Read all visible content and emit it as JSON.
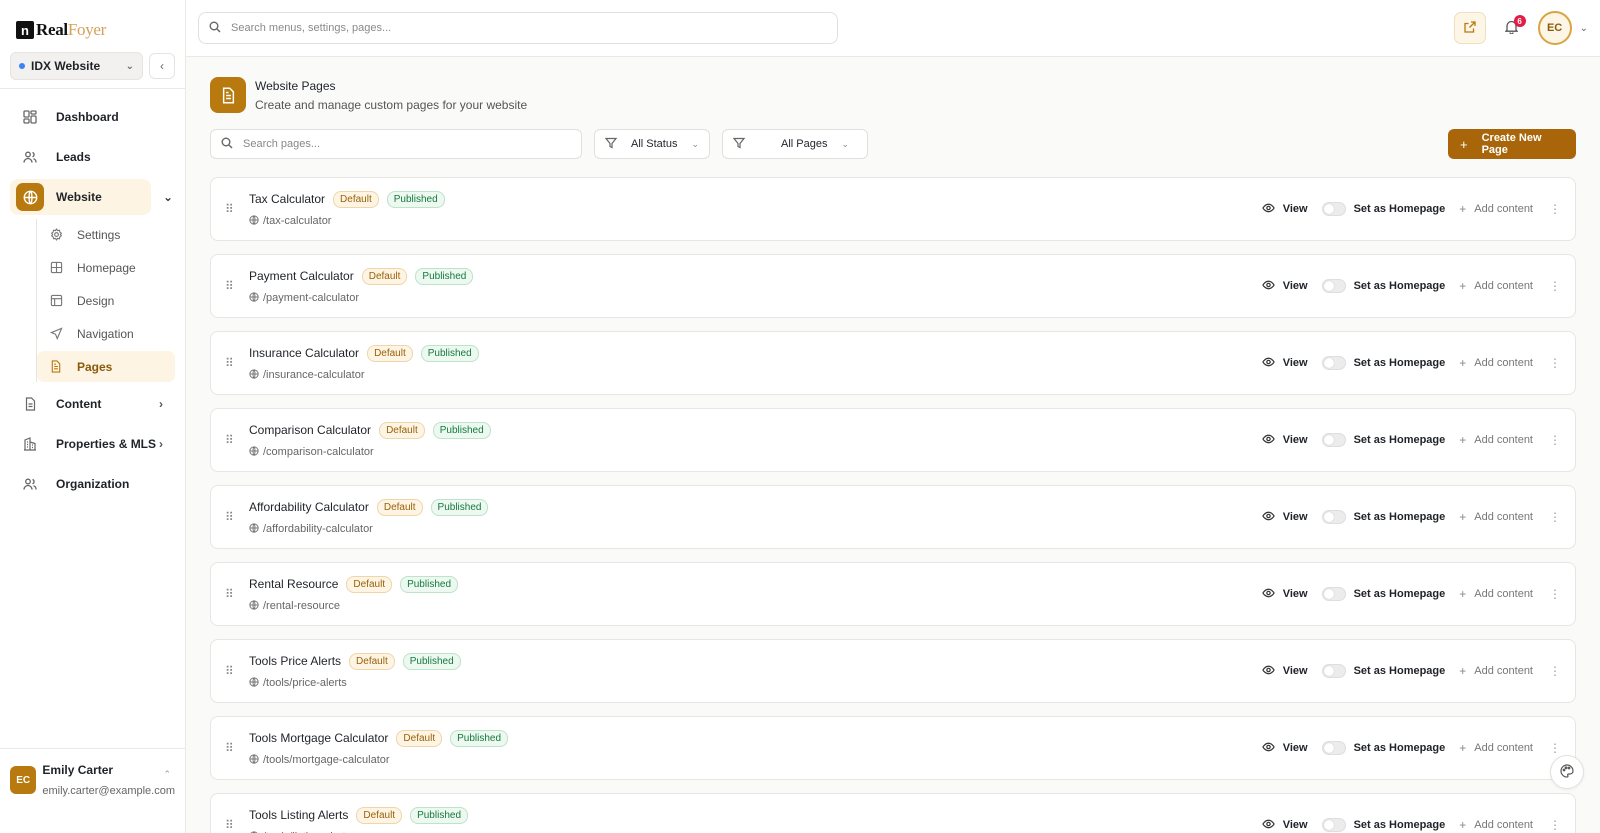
{
  "brand": {
    "mark": "n",
    "name_part1": "Real",
    "name_part2": "Foyer"
  },
  "site_selector": {
    "value": "IDX Website"
  },
  "sidebar": {
    "items": [
      {
        "label": "Dashboard",
        "icon": "grid-icon"
      },
      {
        "label": "Leads",
        "icon": "users-icon"
      },
      {
        "label": "Website",
        "icon": "globe-icon",
        "active": true
      },
      {
        "label": "Content",
        "icon": "document-icon"
      },
      {
        "label": "Properties & MLS",
        "icon": "building-icon"
      },
      {
        "label": "Organization",
        "icon": "team-icon"
      }
    ],
    "subitems": [
      {
        "label": "Settings",
        "icon": "gear-icon"
      },
      {
        "label": "Homepage",
        "icon": "layout-icon"
      },
      {
        "label": "Design",
        "icon": "palette-layout-icon"
      },
      {
        "label": "Navigation",
        "icon": "navigation-icon"
      },
      {
        "label": "Pages",
        "icon": "file-icon",
        "active": true
      }
    ]
  },
  "user": {
    "initials": "EC",
    "name": "Emily Carter",
    "email": "emily.carter@example.com"
  },
  "topbar": {
    "search_placeholder": "Search menus, settings, pages...",
    "notifications_count": "6",
    "avatar_initials": "EC"
  },
  "page": {
    "title": "Website Pages",
    "subtitle": "Create and manage custom pages for your website"
  },
  "toolbar": {
    "search_placeholder": "Search pages...",
    "status_filter": "All Status",
    "pages_filter": "All Pages",
    "create_label": "Create New Page"
  },
  "row_labels": {
    "default_badge": "Default",
    "published_badge": "Published",
    "view": "View",
    "set_home": "Set as Homepage",
    "add_content": "Add content"
  },
  "pages": [
    {
      "title": "Tax Calculator",
      "slug": "/tax-calculator"
    },
    {
      "title": "Payment Calculator",
      "slug": "/payment-calculator"
    },
    {
      "title": "Insurance Calculator",
      "slug": "/insurance-calculator"
    },
    {
      "title": "Comparison Calculator",
      "slug": "/comparison-calculator"
    },
    {
      "title": "Affordability Calculator",
      "slug": "/affordability-calculator"
    },
    {
      "title": "Rental Resource",
      "slug": "/rental-resource"
    },
    {
      "title": "Tools Price Alerts",
      "slug": "/tools/price-alerts"
    },
    {
      "title": "Tools Mortgage Calculator",
      "slug": "/tools/mortgage-calculator"
    },
    {
      "title": "Tools Listing Alerts",
      "slug": "/tools/listing-alerts"
    }
  ],
  "colors": {
    "accent": "#b8790f",
    "accent_dark": "#a8650a",
    "published": "#157a3e",
    "badge_red": "#e11d48"
  }
}
